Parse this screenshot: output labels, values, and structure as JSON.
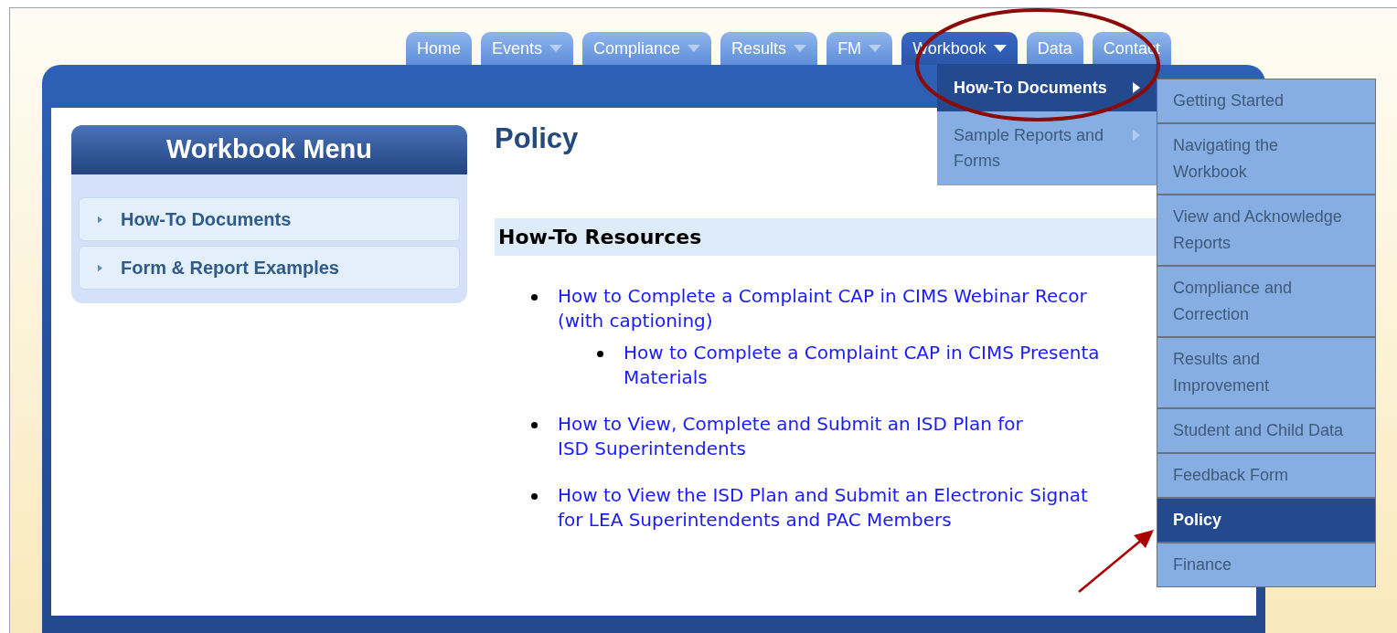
{
  "nav_tabs": [
    {
      "label": "Home",
      "dropdown": false,
      "selected": false
    },
    {
      "label": "Events",
      "dropdown": true,
      "selected": false
    },
    {
      "label": "Compliance",
      "dropdown": true,
      "selected": false
    },
    {
      "label": "Results",
      "dropdown": true,
      "selected": false
    },
    {
      "label": "FM",
      "dropdown": true,
      "selected": false
    },
    {
      "label": "Workbook",
      "dropdown": true,
      "selected": true
    },
    {
      "label": "Data",
      "dropdown": false,
      "selected": false
    },
    {
      "label": "Contact",
      "dropdown": false,
      "selected": false
    }
  ],
  "sidebar": {
    "title": "Workbook Menu",
    "items": [
      {
        "label": "How-To Documents"
      },
      {
        "label": "Form & Report Examples"
      }
    ]
  },
  "page_title": "Policy",
  "section": {
    "title": "How-To Resources",
    "links": [
      {
        "lines": [
          "How to Complete a Complaint CAP in CIMS Webinar Recor",
          "(with captioning)"
        ],
        "children": [
          {
            "lines": [
              "How to Complete a Complaint CAP in CIMS Presenta",
              "Materials"
            ]
          }
        ]
      },
      {
        "lines": [
          "How to View, Complete and Submit an ISD Plan for",
          "ISD Superintendents"
        ]
      },
      {
        "lines": [
          "How to View the ISD Plan and Submit an Electronic Signat",
          "for LEA Superintendents and PAC Members"
        ]
      }
    ]
  },
  "dropdown_menu": {
    "items": [
      {
        "lines": [
          "How-To Documents"
        ],
        "submenu": true,
        "selected": true
      },
      {
        "lines": [
          "Sample Reports and",
          "Forms"
        ],
        "submenu": true,
        "selected": false
      }
    ]
  },
  "submenu": {
    "items": [
      {
        "lines": [
          "Getting Started"
        ],
        "selected": false
      },
      {
        "lines": [
          "Navigating the",
          "Workbook"
        ],
        "selected": false
      },
      {
        "lines": [
          "View and Acknowledge",
          "Reports"
        ],
        "selected": false
      },
      {
        "lines": [
          "Compliance and",
          "Correction"
        ],
        "selected": false
      },
      {
        "lines": [
          "Results and",
          "Improvement"
        ],
        "selected": false
      },
      {
        "lines": [
          "Student and Child Data"
        ],
        "selected": false
      },
      {
        "lines": [
          "Feedback Form"
        ],
        "selected": false
      },
      {
        "lines": [
          "Policy"
        ],
        "selected": true
      },
      {
        "lines": [
          "Finance"
        ],
        "selected": false
      }
    ]
  }
}
